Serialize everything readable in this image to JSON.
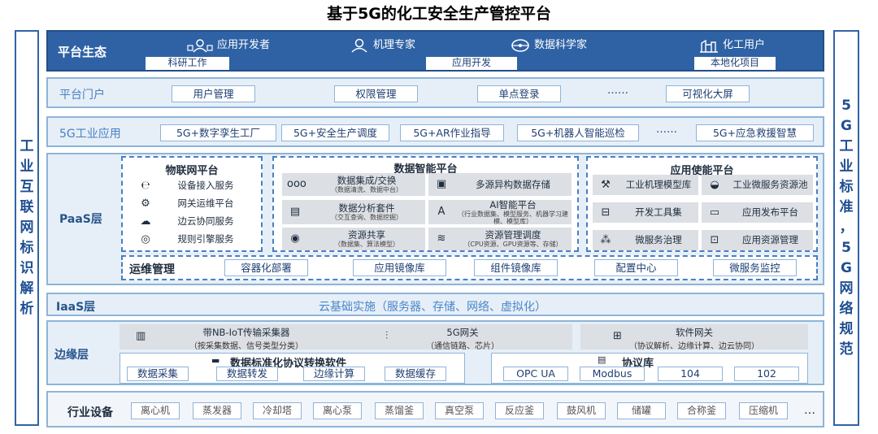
{
  "title": "基于5G的化工安全生产管控平台",
  "left_bar": {
    "chars": [
      "工",
      "业",
      "互",
      "联",
      "网",
      "标",
      "识",
      "解",
      "析"
    ]
  },
  "right_bar": {
    "chars": [
      "5",
      "G",
      "工",
      "业",
      "标",
      "准",
      "，",
      "5",
      "G",
      "网",
      "络",
      "规",
      "范"
    ]
  },
  "eco": {
    "label": "平台生态",
    "roles": [
      {
        "icon": "developer-icon",
        "label": "应用开发者"
      },
      {
        "icon": "expert-icon",
        "label": "机理专家"
      },
      {
        "icon": "data-scientist-icon",
        "label": "数据科学家"
      },
      {
        "icon": "chemical-user-icon",
        "label": "化工用户"
      }
    ],
    "tags": [
      "科研工作",
      "应用开发",
      "本地化项目"
    ]
  },
  "portal": {
    "label": "平台门户",
    "items": [
      "用户管理",
      "权限管理",
      "单点登录",
      "……",
      "可视化大屏"
    ]
  },
  "apps": {
    "label": "5G工业应用",
    "items": [
      "5G+数字孪生工厂",
      "5G+安全生产调度",
      "5G+AR作业指导",
      "5G+机器人智能巡检",
      "……",
      "5G+应急救援智慧"
    ]
  },
  "paas": {
    "label": "PaaS层",
    "iot": {
      "title": "物联网平台",
      "items": [
        {
          "icon": "device-access-icon",
          "label": "设备接入服务"
        },
        {
          "icon": "gateway-ops-icon",
          "label": "网关运维平台"
        },
        {
          "icon": "edge-collab-icon",
          "label": "边云协同服务"
        },
        {
          "icon": "rule-engine-icon",
          "label": "规则引擎服务"
        }
      ]
    },
    "data": {
      "title": "数据智能平台",
      "items": [
        {
          "icon": "data-integration-icon",
          "label": "数据集成/交换",
          "sub": "（数据清洗、数据中台）"
        },
        {
          "icon": "storage-icon",
          "label": "多源异构数据存储",
          "sub": ""
        },
        {
          "icon": "analysis-icon",
          "label": "数据分析套件",
          "sub": "（交互查询、数据挖掘）"
        },
        {
          "icon": "ai-icon",
          "label": "AI智能平台",
          "sub": "（行业数据集、模型服务、机器学习建模、模型库）"
        },
        {
          "icon": "share-icon",
          "label": "资源共享",
          "sub": "（数据集、算法模型）"
        },
        {
          "icon": "schedule-icon",
          "label": "资源管理调度",
          "sub": "（CPU资源、GPU资源等、存储）"
        }
      ]
    },
    "enable": {
      "title": "应用使能平台",
      "items": [
        {
          "icon": "mechanism-model-icon",
          "label": "工业机理模型库"
        },
        {
          "icon": "microservice-pool-icon",
          "label": "工业微服务资源池"
        },
        {
          "icon": "toolkit-icon",
          "label": "开发工具集"
        },
        {
          "icon": "publish-icon",
          "label": "应用发布平台"
        },
        {
          "icon": "service-governance-icon",
          "label": "微服务治理"
        },
        {
          "icon": "resource-mgmt-icon",
          "label": "应用资源管理"
        }
      ]
    },
    "ops": {
      "label": "运维管理",
      "items": [
        "容器化部署",
        "应用镜像库",
        "组件镜像库",
        "配置中心",
        "微服务监控"
      ]
    }
  },
  "iaas": {
    "label": "IaaS层",
    "text": "云基础实施（服务器、存储、网络、虚拟化）"
  },
  "edge": {
    "label": "边缘层",
    "modules": [
      {
        "icon": "nb-iot-icon",
        "label": "带NB-IoT传输采集器",
        "sub": "（按采集数据、信号类型分类）"
      },
      {
        "icon": "router-icon",
        "label": "5G网关",
        "sub": "（通信链路、芯片）"
      },
      {
        "icon": "software-gateway-icon",
        "label": "软件网关",
        "sub": "（协议解析、边缘计算、边云协同）"
      }
    ],
    "convert": {
      "title": "数据标准化协议转换软件",
      "items": [
        "数据采集",
        "数据转发",
        "边缘计算",
        "数据缓存"
      ]
    },
    "protocol": {
      "title": "协议库",
      "items": [
        "OPC UA",
        "Modbus",
        "104",
        "102"
      ]
    }
  },
  "devices": {
    "label": "行业设备",
    "items": [
      "离心机",
      "蒸发器",
      "冷却塔",
      "离心泵",
      "蒸馏釜",
      "真空泵",
      "反应釜",
      "鼓风机",
      "储罐",
      "合称釜",
      "压缩机"
    ],
    "more": "…"
  }
}
